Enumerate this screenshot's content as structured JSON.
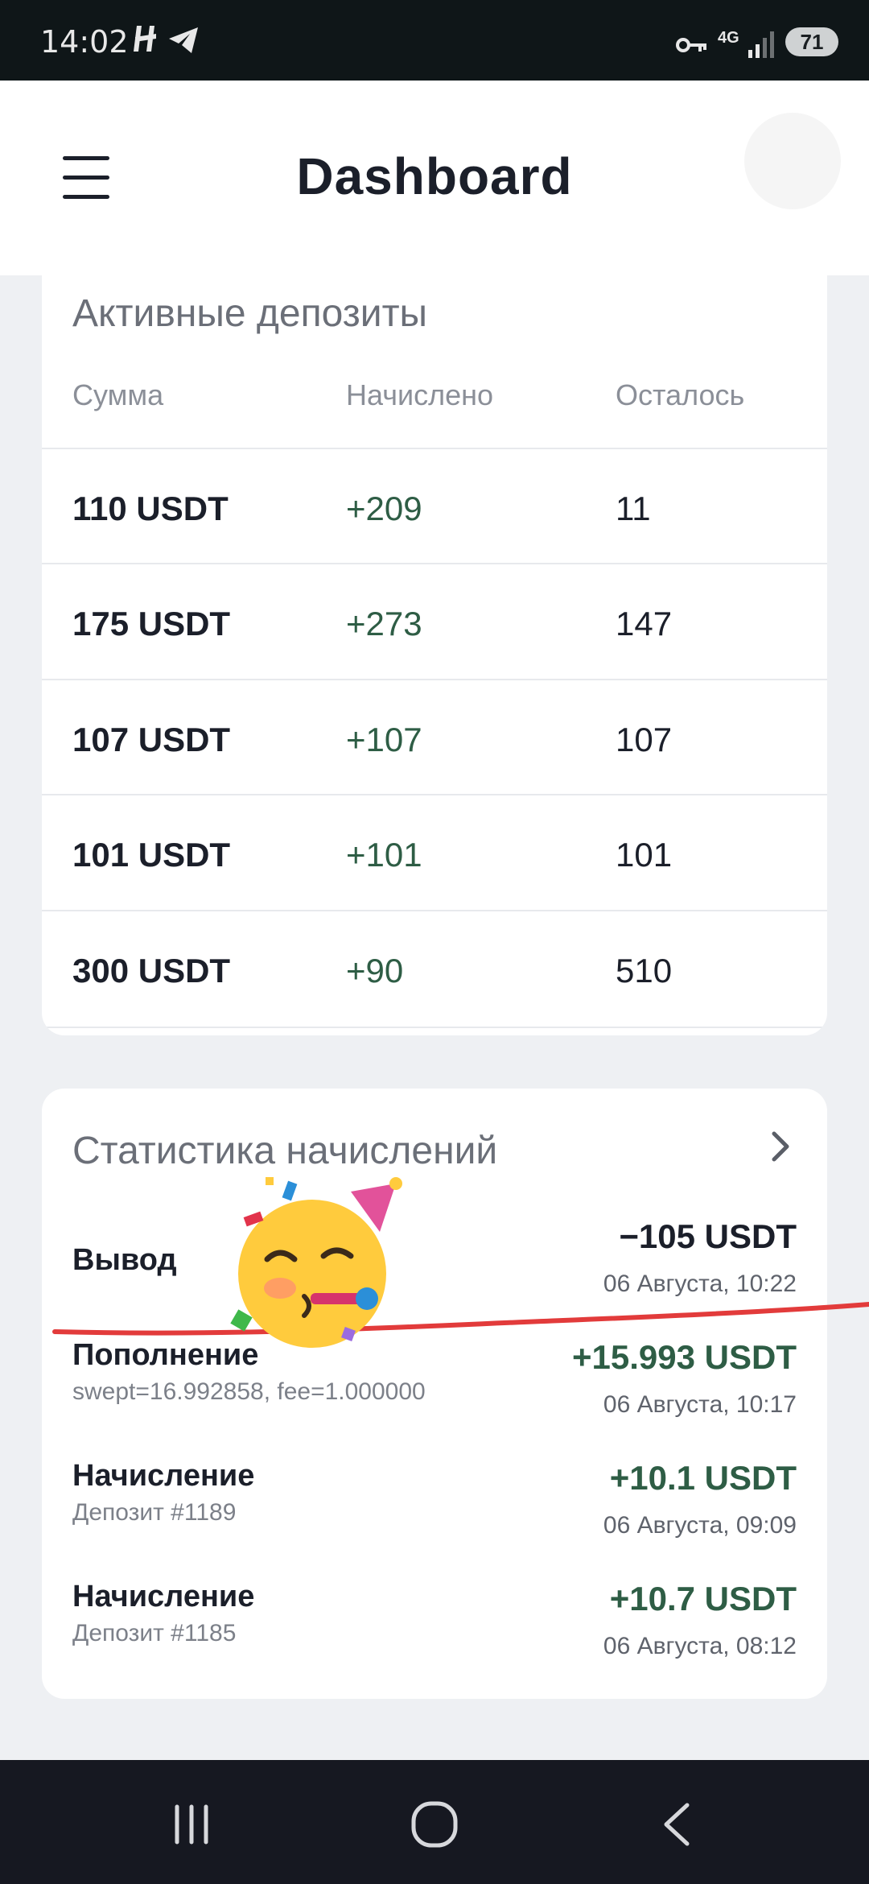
{
  "status_bar": {
    "time": "14:02",
    "network": "4G",
    "battery": "71",
    "icons": [
      "hashtag-app-icon",
      "telegram-icon",
      "vpn-key-icon",
      "signal-icon"
    ]
  },
  "header": {
    "title": "Dashboard",
    "menu_icon": "hamburger-menu-icon"
  },
  "deposits": {
    "title": "Активные депозиты",
    "columns": [
      "Сумма",
      "Начислено",
      "Осталось"
    ],
    "rows": [
      {
        "amount": "110 USDT",
        "accrued": "+209",
        "remaining": "11"
      },
      {
        "amount": "175 USDT",
        "accrued": "+273",
        "remaining": "147"
      },
      {
        "amount": "107 USDT",
        "accrued": "+107",
        "remaining": "107"
      },
      {
        "amount": "101 USDT",
        "accrued": "+101",
        "remaining": "101"
      },
      {
        "amount": "300 USDT",
        "accrued": "+90",
        "remaining": "510"
      }
    ]
  },
  "stats": {
    "title": "Статистика начислений",
    "transactions": [
      {
        "type": "Вывод",
        "note": "",
        "amount": "−105 USDT",
        "date": "06 Августа, 10:22"
      },
      {
        "type": "Пополнение",
        "note": "swept=16.992858, fee=1.000000",
        "amount": "+15.993 USDT",
        "date": "06 Августа, 10:17"
      },
      {
        "type": "Начисление",
        "note": "Депозит #1189",
        "amount": "+10.1 USDT",
        "date": "06 Августа, 09:09"
      },
      {
        "type": "Начисление",
        "note": "Депозит #1185",
        "amount": "+10.7 USDT",
        "date": "06 Августа, 08:12"
      }
    ]
  },
  "colors": {
    "positive": "#2e5d45",
    "background": "#eef0f3",
    "annotation_line": "#e23b3b"
  },
  "overlay": {
    "sticker": "partying-face-emoji"
  },
  "nav": {
    "buttons": [
      "recent-apps-icon",
      "home-icon",
      "back-icon"
    ]
  }
}
